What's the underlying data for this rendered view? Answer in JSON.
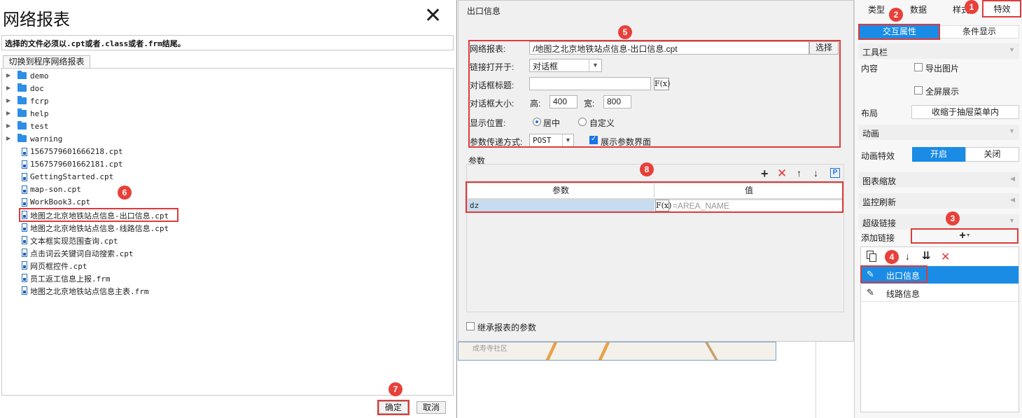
{
  "left_dialog": {
    "title": "网络报表",
    "hint": "选择的文件必须以.cpt或者.class或者.frm结尾。",
    "switch_button": "切换到程序网络报表",
    "folders": [
      "demo",
      "doc",
      "fcrp",
      "help",
      "test",
      "warning"
    ],
    "files": [
      "1567579601666218.cpt",
      "1567579601662181.cpt",
      "GettingStarted.cpt",
      "map-son.cpt",
      "WorkBook3.cpt",
      "地图之北京地铁站点信息-出口信息.cpt",
      "地图之北京地铁站点信息-线路信息.cpt",
      "文本框实现范围查询.cpt",
      "点击词云关键词自动搜索.cpt",
      "网页框控件.cpt",
      "员工返工信息上报.frm",
      "地图之北京地铁站点信息主表.frm"
    ],
    "ok": "确定",
    "cancel": "取消"
  },
  "center": {
    "header": "出口信息",
    "labels": {
      "report": "网络报表:",
      "open_in": "链接打开于:",
      "dialog_title": "对话框标题:",
      "dialog_size": "对话框大小:",
      "height": "高:",
      "width": "宽:",
      "position": "显示位置:",
      "param_mode": "参数传递方式:"
    },
    "report_path": "/地图之北京地铁站点信息-出口信息.cpt",
    "choose": "选择",
    "open_in_value": "对话框",
    "dialog_title_value": "",
    "height_value": "400",
    "width_value": "800",
    "position_center": "居中",
    "position_custom": "自定义",
    "param_mode_value": "POST",
    "show_param_ui": "展示参数界面",
    "params_title": "参数",
    "col_param": "参数",
    "col_value": "值",
    "param_name": "dz",
    "param_value": "=AREA_NAME",
    "inherit": "继承报表的参数",
    "map_label": "成寿寺社区",
    "fx": "F(x)",
    "p_icon": "P"
  },
  "right_panel": {
    "tabs": [
      "类型",
      "数据",
      "样式",
      "特效"
    ],
    "subtabs": [
      "交互属性",
      "条件显示"
    ],
    "toolbar_section": "工具栏",
    "content_label": "内容",
    "export_image": "导出图片",
    "fullscreen": "全屏展示",
    "layout_label": "布局",
    "layout_value": "收缩于抽屉菜单内",
    "animation_section": "动画",
    "animation_effect": "动画特效",
    "anim_on": "开启",
    "anim_off": "关闭",
    "zoom_section": "图表缩放",
    "monitor_section": "监控刷新",
    "hyperlink_section": "超级链接",
    "add_link": "添加链接",
    "links": [
      "出口信息",
      "线路信息"
    ]
  },
  "badges": [
    "1",
    "2",
    "3",
    "4",
    "5",
    "6",
    "7",
    "8"
  ],
  "colors": {
    "accent": "#1a8ce6",
    "annotation_red": "#e03a3a"
  }
}
